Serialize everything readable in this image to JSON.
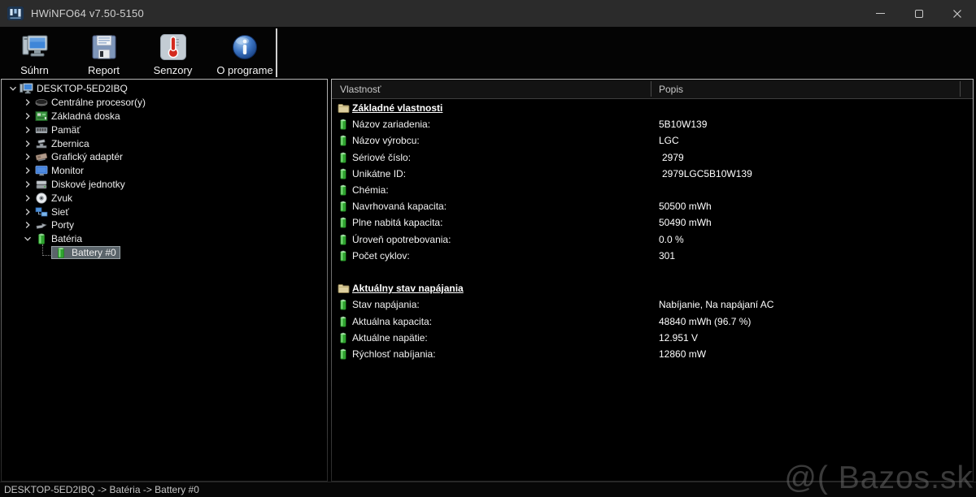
{
  "window": {
    "title": "HWiNFO64 v7.50-5150"
  },
  "toolbar": {
    "buttons": [
      {
        "label": "Súhrn",
        "icon": "computer-summary-icon"
      },
      {
        "label": "Report",
        "icon": "floppy-report-icon"
      },
      {
        "label": "Senzory",
        "icon": "thermometer-sensors-icon"
      },
      {
        "label": "O programe",
        "icon": "info-about-icon"
      }
    ]
  },
  "tree": {
    "root": {
      "label": "DESKTOP-5ED2IBQ",
      "icon": "computer-icon",
      "expanded": true
    },
    "items": [
      {
        "label": "Centrálne procesor(y)",
        "icon": "cpu-icon"
      },
      {
        "label": "Základná doska",
        "icon": "motherboard-icon"
      },
      {
        "label": "Pamäť",
        "icon": "memory-icon"
      },
      {
        "label": "Zbernica",
        "icon": "bus-icon"
      },
      {
        "label": "Grafický adaptér",
        "icon": "gpu-icon"
      },
      {
        "label": "Monitor",
        "icon": "monitor-icon"
      },
      {
        "label": "Diskové jednotky",
        "icon": "disk-icon"
      },
      {
        "label": "Zvuk",
        "icon": "audio-icon"
      },
      {
        "label": "Sieť",
        "icon": "network-icon"
      },
      {
        "label": "Porty",
        "icon": "ports-icon"
      },
      {
        "label": "Batéria",
        "icon": "battery-icon",
        "expanded": true
      }
    ],
    "selected": {
      "label": "Battery #0",
      "icon": "battery-icon"
    }
  },
  "detail": {
    "columns": {
      "property": "Vlastnosť",
      "description": "Popis"
    },
    "sections": [
      {
        "title": "Základné vlastnosti",
        "icon": "folder-section-icon",
        "rows": [
          {
            "property": "Názov zariadenia:",
            "value": "5B10W139"
          },
          {
            "property": "Názov výrobcu:",
            "value": "LGC"
          },
          {
            "property": "Sériové číslo:",
            "value": "2979"
          },
          {
            "property": "Unikátne ID:",
            "value": "2979LGC5B10W139"
          },
          {
            "property": "Chémia:",
            "value": ""
          },
          {
            "property": "Navrhovaná kapacita:",
            "value": "50500 mWh"
          },
          {
            "property": "Plne nabitá kapacita:",
            "value": "50490 mWh"
          },
          {
            "property": "Úroveň opotrebovania:",
            "value": "0.0 %"
          },
          {
            "property": "Počet cyklov:",
            "value": "301"
          }
        ]
      },
      {
        "title": "Aktuálny stav napájania",
        "icon": "folder-section-icon",
        "rows": [
          {
            "property": "Stav napájania:",
            "value": "Nabíjanie, Na napájaní AC"
          },
          {
            "property": "Aktuálna kapacita:",
            "value": "48840 mWh (96.7 %)"
          },
          {
            "property": "Aktuálne napätie:",
            "value": "12.951 V"
          },
          {
            "property": "Rýchlosť nabíjania:",
            "value": "12860 mW"
          }
        ]
      }
    ]
  },
  "statusbar": {
    "path": "DESKTOP-5ED2IBQ -> Batéria -> Battery #0"
  },
  "watermark": {
    "text": "@( Bazos.sk"
  },
  "colors": {
    "titlebar": "#2b2b2b",
    "background": "#000000",
    "battery_green": "#2fa32f",
    "folder_tan": "#ddcf9e",
    "selection": "#5a646a",
    "screen_blue": "#3f86d8"
  }
}
